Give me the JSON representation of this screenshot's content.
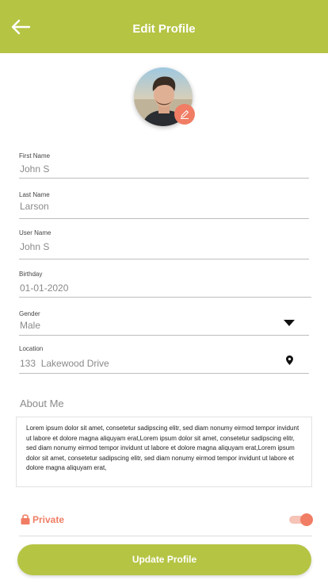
{
  "header": {
    "title": "Edit Profile",
    "back_icon": "arrow-left-icon"
  },
  "avatar": {
    "alt": "Profile photo",
    "edit_icon": "pencil-icon"
  },
  "fields": {
    "first_name": {
      "label": "First Name",
      "value": "John S"
    },
    "last_name": {
      "label": "Last Name",
      "value": "Larson"
    },
    "user_name": {
      "label": "User Name",
      "value": "John S"
    },
    "birthday": {
      "label": "Birthday",
      "value": "01-01-2020"
    },
    "gender": {
      "label": "Gender",
      "value": "Male"
    },
    "location": {
      "label": "Location",
      "value": "133  Lakewood Drive"
    }
  },
  "about": {
    "title": "About Me",
    "text": "Lorem ipsum dolor sit amet, consetetur sadipscing elitr, sed diam nonumy eirmod tempor invidunt ut labore et dolore magna aliquyam erat,Lorem ipsum dolor sit amet, consetetur sadipscing elitr, sed diam nonumy eirmod tempor invidunt ut labore et dolore magna aliquyam erat,Lorem ipsum dolor sit amet, consetetur sadipscing elitr, sed diam nonumy eirmod tempor invidunt ut labore et dolore magna aliquyam erat,"
  },
  "privacy": {
    "label": "Private",
    "enabled": true
  },
  "actions": {
    "update_label": "Update Profile"
  },
  "colors": {
    "accent": "#b5c443",
    "highlight": "#f07d64",
    "text_muted": "#8a8a8a"
  }
}
